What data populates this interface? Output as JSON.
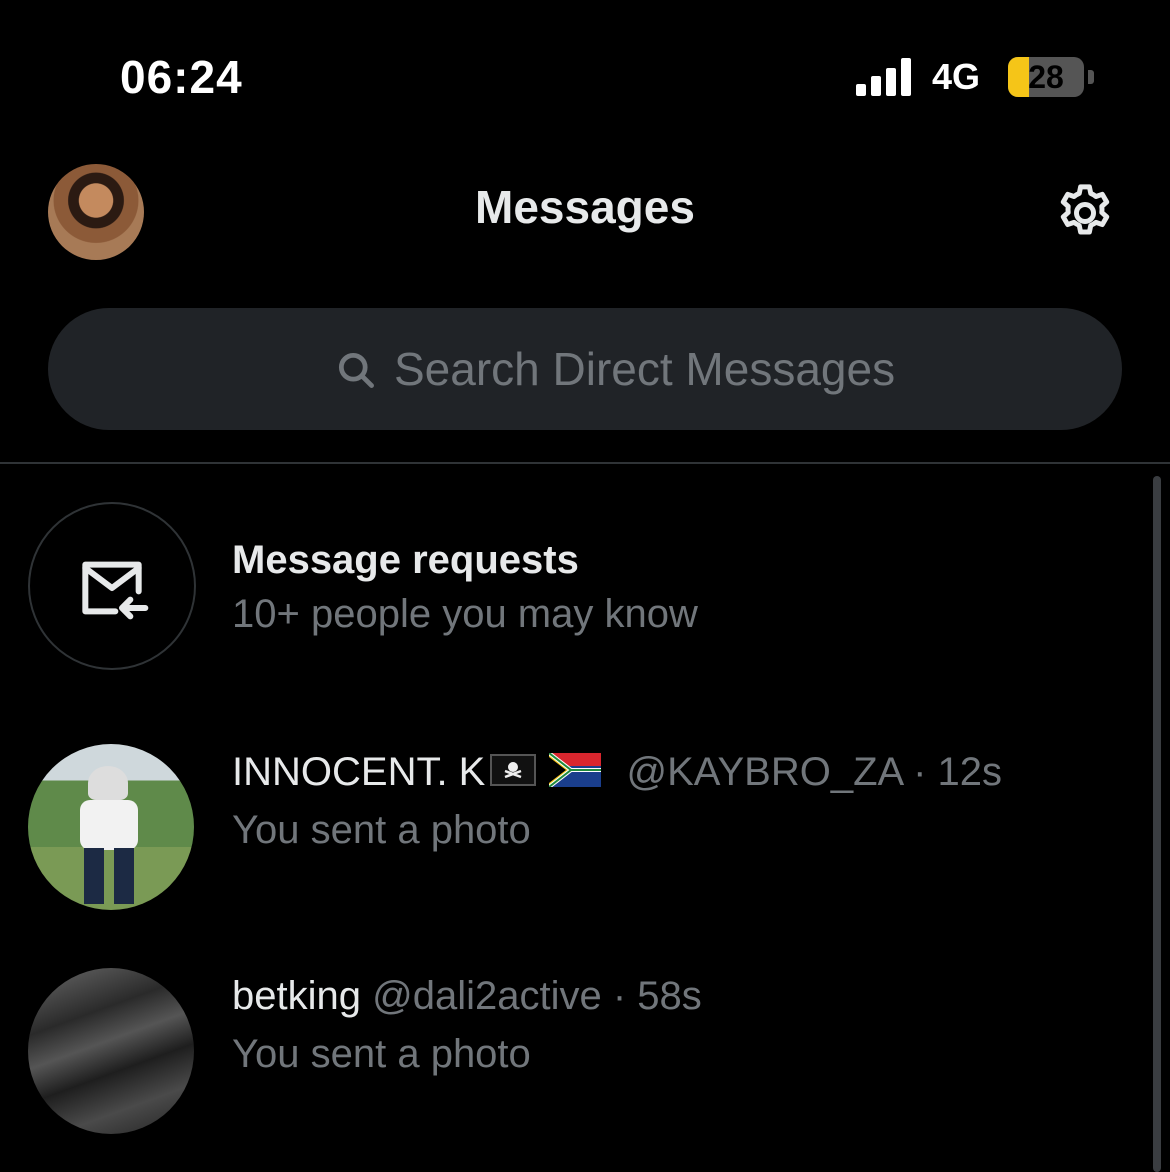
{
  "status_bar": {
    "time": "06:24",
    "network": "4G",
    "battery": "28",
    "battery_level": 0.28,
    "battery_color": "#f5c518"
  },
  "header": {
    "title": "Messages",
    "avatar_icon": "profile-avatar",
    "settings_icon": "gear-icon"
  },
  "search": {
    "placeholder": "Search Direct Messages",
    "icon": "search-icon"
  },
  "requests": {
    "title": "Message requests",
    "subtitle": "10+ people you may know",
    "icon": "envelope-incoming-icon"
  },
  "conversations": [
    {
      "name": "INNOCENT. K",
      "flags": [
        "pirate-flag-icon",
        "south-africa-flag-icon"
      ],
      "handle": "@KAYBRO_ZA",
      "time": "· 12s",
      "preview": "You sent a photo"
    },
    {
      "name": "betking",
      "handle": "@dali2active",
      "time": "· 58s",
      "preview": "You sent a photo"
    }
  ],
  "colors": {
    "background": "#000000",
    "primary_text": "#e7e9ea",
    "secondary_text": "#71767b",
    "search_bg": "#202327",
    "divider": "#2f3336"
  }
}
